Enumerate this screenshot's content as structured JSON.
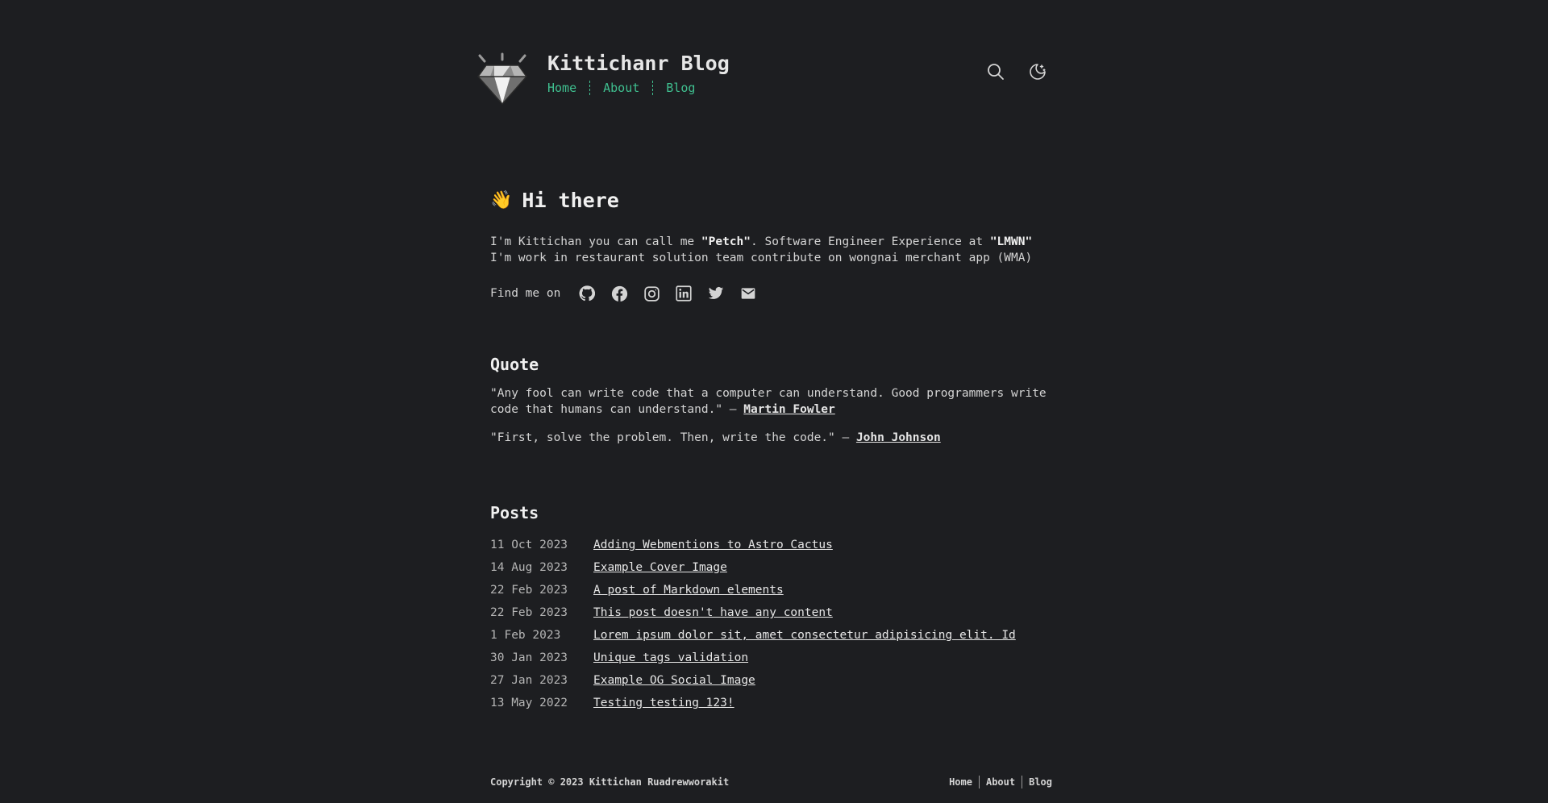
{
  "header": {
    "site_title": "Kittichanr Blog",
    "nav": [
      "Home",
      "About",
      "Blog"
    ],
    "icons": [
      "diamond-logo",
      "search-icon",
      "moon-icon"
    ]
  },
  "intro": {
    "wave_emoji": "👋",
    "heading": "Hi there",
    "text_1": "I'm Kittichan you can call me ",
    "name": "\"Petch\"",
    "text_2": ". Software Engineer Experience at ",
    "company": "\"LMWN\"",
    "text_3": " I'm work in restaurant solution team contribute on wongnai merchant app (WMA)",
    "find_me_label": "Find me on",
    "social_icons": [
      "github-icon",
      "facebook-icon",
      "instagram-icon",
      "linkedin-icon",
      "twitter-icon",
      "email-icon"
    ]
  },
  "quotes": {
    "heading": "Quote",
    "items": [
      {
        "text": "\"Any fool can write code that a computer can understand. Good programmers write code that humans can understand.\" — ",
        "author": "Martin Fowler"
      },
      {
        "text": "\"First, solve the problem. Then, write the code.\" — ",
        "author": "John Johnson"
      }
    ]
  },
  "posts": {
    "heading": "Posts",
    "items": [
      {
        "date": "11 Oct 2023",
        "title": "Adding Webmentions to Astro Cactus"
      },
      {
        "date": "14 Aug 2023",
        "title": "Example Cover Image"
      },
      {
        "date": "22 Feb 2023",
        "title": "A post of Markdown elements"
      },
      {
        "date": "22 Feb 2023",
        "title": "This post doesn't have any content"
      },
      {
        "date": "1 Feb 2023",
        "title": "Lorem ipsum dolor sit, amet consectetur adipisicing elit. Id"
      },
      {
        "date": "30 Jan 2023",
        "title": "Unique tags validation"
      },
      {
        "date": "27 Jan 2023",
        "title": "Example OG Social Image"
      },
      {
        "date": "13 May 2022",
        "title": "Testing testing 123!"
      }
    ]
  },
  "footer": {
    "copyright": "Copyright © 2023 Kittichan Ruadrewworakit",
    "nav": [
      "Home",
      "About",
      "Blog"
    ]
  },
  "colors": {
    "background": "#1d1e21",
    "text": "#d4d4d4",
    "accent": "#3fbf8f"
  }
}
